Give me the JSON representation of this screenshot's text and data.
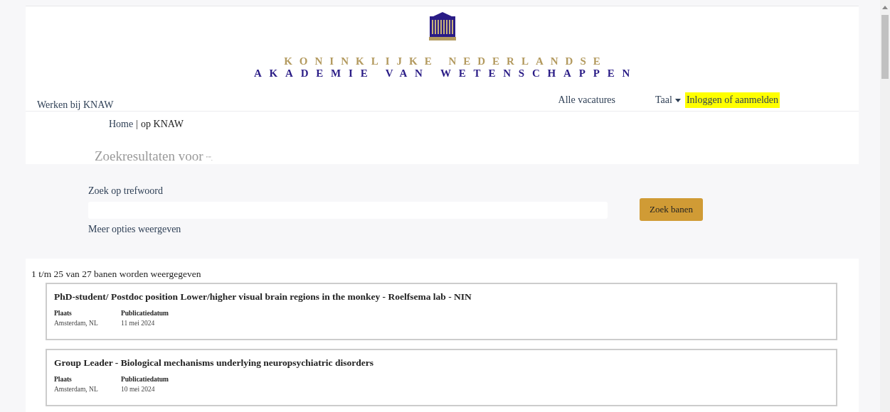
{
  "header": {
    "logo_line_1": "KONINKLIJKE NEDERLANDSE",
    "logo_line_2": "AKADEMIE VAN WETENSCHAPPEN",
    "site_link": "Werken bij KNAW",
    "nav": [
      {
        "label": "Alle vacatures",
        "kind": "link"
      },
      {
        "label": "Taal",
        "kind": "dropdown"
      },
      {
        "label": "Inloggen of aanmelden",
        "kind": "highlight"
      }
    ]
  },
  "breadcrumb": {
    "home": "Home",
    "separator": "|",
    "current": "op KNAW"
  },
  "results_heading": "Zoekresultaten voor",
  "results_query": "\"\".",
  "search": {
    "label": "Zoek op trefwoord",
    "button": "Zoek banen",
    "more_options": "Meer opties weergeven"
  },
  "results_count": "1 t/m 25 van 27 banen worden weergegeven",
  "jobs": [
    {
      "title": "PhD-student/ Postdoc position Lower/higher visual brain regions in the monkey - Roelfsema lab - NIN",
      "place_label": "Plaats",
      "place": "Amsterdam, NL",
      "date_label": "Publicatiedatum",
      "date": "11 mei 2024"
    },
    {
      "title": "Group Leader - Biological mechanisms underlying neuropsychiatric disorders",
      "place_label": "Plaats",
      "place": "Amsterdam, NL",
      "date_label": "Publicatiedatum",
      "date": "10 mei 2024"
    }
  ]
}
